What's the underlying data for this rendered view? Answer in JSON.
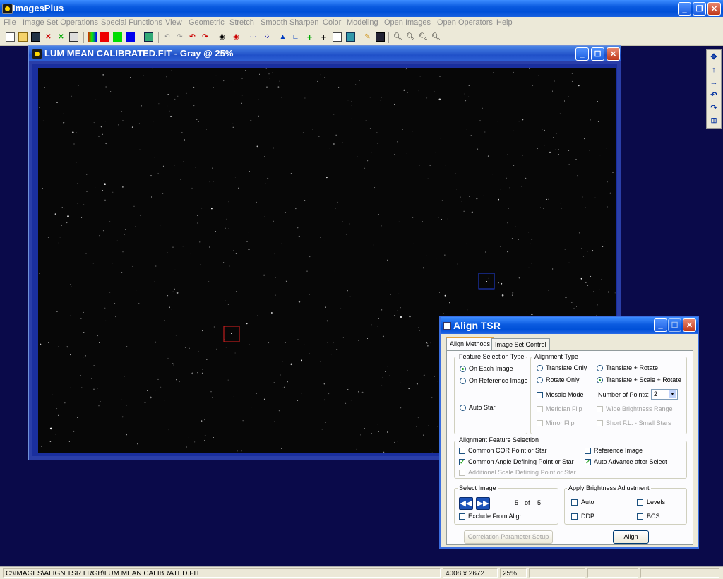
{
  "app": {
    "title": "ImagesPlus",
    "menu": [
      "File",
      "Image Set Operations",
      "Special Functions",
      "View",
      "Geometric",
      "Stretch",
      "Smooth Sharpen",
      "Color",
      "Modeling",
      "Open Images",
      "Open Operators",
      "Help"
    ]
  },
  "image_window": {
    "title": "LUM MEAN CALIBRATED.FIT - Gray @ 25%"
  },
  "dialog": {
    "title": "Align TSR",
    "tabs": [
      "Align Methods",
      "Image Set Control"
    ],
    "feature_selection": {
      "label": "Feature Selection Type",
      "options": [
        "On Each Image",
        "On Reference Image",
        "Auto Star"
      ]
    },
    "alignment_type": {
      "label": "Alignment Type",
      "translate_only": "Translate Only",
      "translate_rotate": "Translate + Rotate",
      "rotate_only": "Rotate Only",
      "translate_scale_rotate": "Translate + Scale + Rotate",
      "mosaic_mode": "Mosaic Mode",
      "num_points_label": "Number of Points:",
      "num_points_value": "2",
      "meridian_flip": "Meridian Flip",
      "wide_brightness": "Wide Brightness Range",
      "mirror_flip": "Mirror Flip",
      "short_fl": "Short F.L. - Small Stars"
    },
    "alignment_feature": {
      "label": "Alignment Feature Selection",
      "common_cor": "Common COR Point or Star",
      "reference_image": "Reference Image",
      "common_angle": "Common Angle Defining Point or Star",
      "auto_advance": "Auto Advance after Select",
      "additional_scale": "Additional Scale Defining Point or Star"
    },
    "select_image": {
      "label": "Select Image",
      "current": "5",
      "of": "of",
      "total": "5",
      "exclude": "Exclude From Align"
    },
    "brightness": {
      "label": "Apply Brightness Adjustment",
      "auto": "Auto",
      "levels": "Levels",
      "ddp": "DDP",
      "bcs": "BCS"
    },
    "correlation_button": "Correlation Parameter Setup",
    "align_button": "Align"
  },
  "status": {
    "path": "C:\\IMAGES\\ALIGN TSR LRGB\\LUM MEAN CALIBRATED.FIT",
    "dimensions": "4008 x 2672",
    "zoom": "25%"
  }
}
